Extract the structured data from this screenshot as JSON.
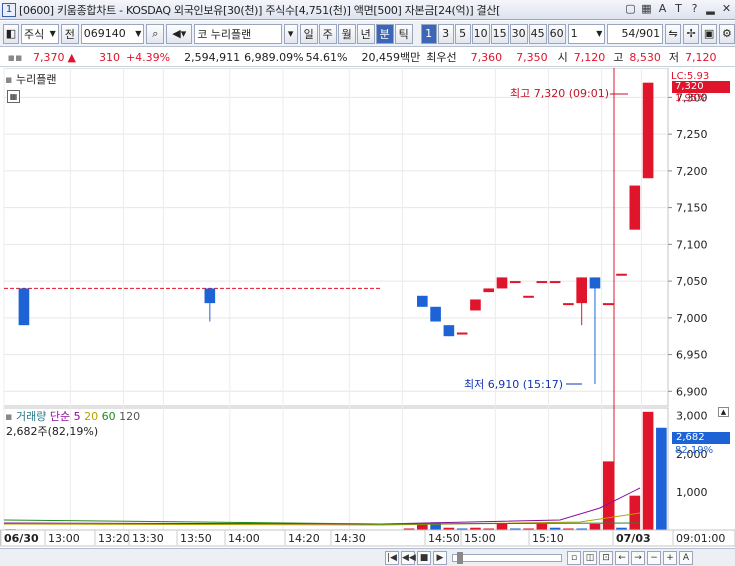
{
  "title": "[0600] 키움종합차트 - KOSDAQ 외국인보유[30(천)] 주식수[4,751(천)] 액면[500] 자본금[24(억)] 결산[",
  "title_icons": [
    "window-icon",
    "grid-icon",
    "text-icon",
    "t-icon",
    "help-icon",
    "minimize-icon",
    "close-icon"
  ],
  "toolbar": {
    "type_select": "주식",
    "mode_label": "전",
    "code": "069140",
    "name": "코 누리플랜",
    "periods": [
      "일",
      "주",
      "월",
      "년",
      "분",
      "틱"
    ],
    "selected_period": "분",
    "intervals": [
      "1",
      "3",
      "5",
      "10",
      "15",
      "30",
      "45",
      "60"
    ],
    "selected_interval": "1",
    "interval_select": "1",
    "count": "54",
    "count_total": "/901"
  },
  "quote": {
    "price": "7,370",
    "arrow": "▲",
    "change": "310",
    "change_pct": "+4.39%",
    "volume": "2,594,911",
    "turnover_pct": "6,989.09%",
    "foreign_pct": "54.61%",
    "amount": "20,459백만",
    "bid_label": "최우선",
    "bid1": "7,360",
    "bid2": "7,350",
    "open_label": "시",
    "open": "7,120",
    "high_label": "고",
    "high": "8,530",
    "low_label": "저",
    "low": "7,120"
  },
  "colors": {
    "up": "#e0142b",
    "down": "#1e63d6",
    "ref": "#e0142b"
  },
  "price_panel": {
    "title": "누리플랜",
    "lc_label": "LC:5.93",
    "current_label": "7,320",
    "current_pct": "1.95%",
    "high_annot": "최고 7,320 (09:01)",
    "low_annot": "최저 6,910 (15:17)"
  },
  "volume_panel": {
    "title": "거래량",
    "ma_label": "단순",
    "ma_periods": [
      "5",
      "20",
      "60",
      "120"
    ],
    "ma_colors": [
      "#8a0f9c",
      "#b5a100",
      "#1f8a1f",
      "#555555"
    ],
    "value_label": "2,682주(82,19%)",
    "current_label": "2,682",
    "current_pct": "82.19%",
    "y_ticks": [
      "3,000",
      "2,000",
      "1,000"
    ]
  },
  "x_labels": [
    "06/30",
    "13:00",
    "13:20",
    "13:30",
    "13:50",
    "14:00",
    "14:20",
    "14:30",
    "14:50",
    "15:00",
    "15:10",
    "07/03",
    "09:01:00"
  ],
  "chart_data": {
    "type": "candlestick",
    "y_ticks": [
      7300,
      7250,
      7200,
      7150,
      7100,
      7050,
      7000,
      6950,
      6900
    ],
    "ylim": [
      6880,
      7340
    ],
    "reference_price": 7040,
    "candles": [
      {
        "x": 1,
        "open": 7040,
        "close": 6990,
        "high": 7040,
        "low": 6990
      },
      {
        "x": 15,
        "open": 7040,
        "close": 7020,
        "high": 7040,
        "low": 6995
      },
      {
        "x": 31,
        "open": 7030,
        "close": 7015,
        "high": 7030,
        "low": 7015
      },
      {
        "x": 32,
        "open": 7015,
        "close": 6995,
        "high": 7015,
        "low": 6995
      },
      {
        "x": 33,
        "open": 6990,
        "close": 6975,
        "high": 6990,
        "low": 6975
      },
      {
        "x": 34,
        "open": 6980,
        "close": 6980,
        "high": 6980,
        "low": 6980
      },
      {
        "x": 35,
        "open": 7010,
        "close": 7025,
        "high": 7025,
        "low": 7010
      },
      {
        "x": 36,
        "open": 7035,
        "close": 7040,
        "high": 7040,
        "low": 7035
      },
      {
        "x": 37,
        "open": 7040,
        "close": 7055,
        "high": 7055,
        "low": 7040
      },
      {
        "x": 38,
        "open": 7050,
        "close": 7050,
        "high": 7050,
        "low": 7050
      },
      {
        "x": 39,
        "open": 7030,
        "close": 7030,
        "high": 7030,
        "low": 7030
      },
      {
        "x": 40,
        "open": 7050,
        "close": 7050,
        "high": 7050,
        "low": 7050
      },
      {
        "x": 41,
        "open": 7050,
        "close": 7050,
        "high": 7050,
        "low": 7050
      },
      {
        "x": 42,
        "open": 7020,
        "close": 7020,
        "high": 7020,
        "low": 7020
      },
      {
        "x": 43,
        "open": 7020,
        "close": 7055,
        "high": 7055,
        "low": 6990
      },
      {
        "x": 44,
        "open": 7055,
        "close": 7040,
        "high": 7055,
        "low": 6910
      },
      {
        "x": 45,
        "open": 7020,
        "close": 7020,
        "high": 7020,
        "low": 7020
      },
      {
        "x": 46,
        "open": 7060,
        "close": 7060,
        "high": 7060,
        "low": 7060
      },
      {
        "x": 47,
        "open": 7120,
        "close": 7180,
        "high": 7180,
        "low": 7120
      },
      {
        "x": 48,
        "open": 7190,
        "close": 7320,
        "high": 7320,
        "low": 7190
      }
    ],
    "volume": {
      "ylim": [
        0,
        3200
      ],
      "values": [
        20,
        0,
        0,
        0,
        0,
        0,
        0,
        0,
        0,
        0,
        0,
        0,
        0,
        0,
        0,
        0,
        0,
        0,
        0,
        0,
        0,
        0,
        0,
        0,
        0,
        0,
        0,
        0,
        0,
        0,
        40,
        180,
        200,
        60,
        40,
        60,
        40,
        160,
        40,
        40,
        160,
        60,
        40,
        40,
        160,
        1800,
        60,
        900,
        3100,
        2682
      ],
      "up": [
        true,
        false,
        false,
        false,
        false,
        false,
        false,
        false,
        false,
        false,
        false,
        false,
        false,
        false,
        false,
        false,
        false,
        false,
        false,
        false,
        false,
        false,
        false,
        false,
        false,
        false,
        false,
        false,
        false,
        false,
        true,
        true,
        false,
        true,
        false,
        true,
        true,
        true,
        false,
        true,
        true,
        false,
        true,
        false,
        true,
        true,
        false,
        true,
        true,
        false
      ]
    }
  }
}
